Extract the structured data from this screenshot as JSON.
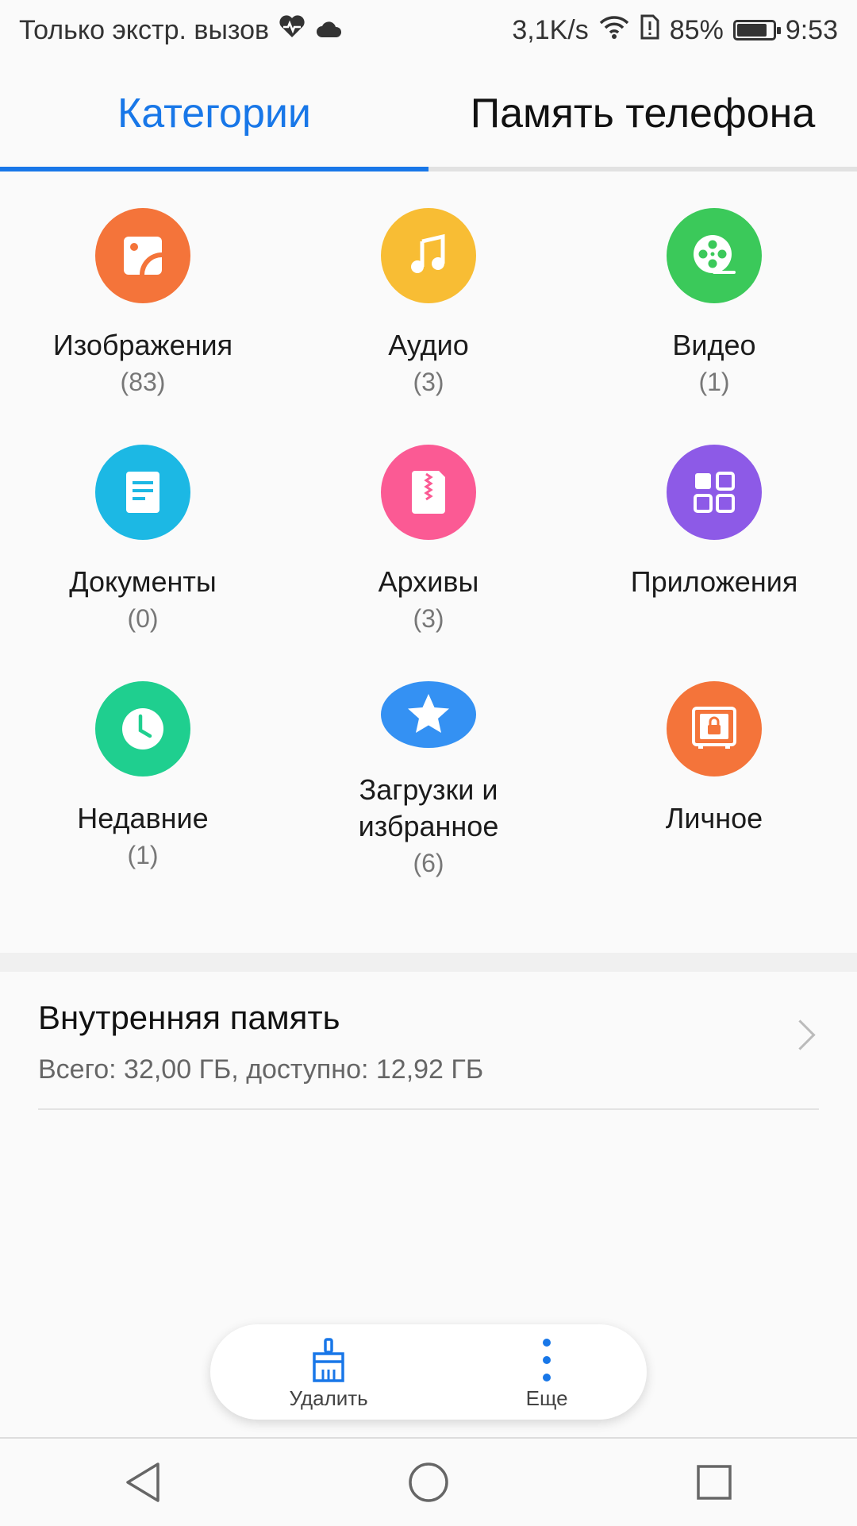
{
  "status": {
    "left_text": "Только экстр. вызов",
    "speed": "3,1K/s",
    "battery": "85%",
    "battery_level": 0.85,
    "time": "9:53"
  },
  "tabs": [
    {
      "label": "Категории",
      "active": true
    },
    {
      "label": "Память телефона",
      "active": false
    }
  ],
  "categories": [
    {
      "label": "Изображения",
      "count": "(83)",
      "color": "#f4743a",
      "icon": "image-icon"
    },
    {
      "label": "Аудио",
      "count": "(3)",
      "color": "#f8bd34",
      "icon": "music-note-icon"
    },
    {
      "label": "Видео",
      "count": "(1)",
      "color": "#3bc95a",
      "icon": "film-reel-icon"
    },
    {
      "label": "Документы",
      "count": "(0)",
      "color": "#1cb8e4",
      "icon": "document-icon"
    },
    {
      "label": "Архивы",
      "count": "(3)",
      "color": "#fb5a94",
      "icon": "archive-zip-icon"
    },
    {
      "label": "Приложения",
      "count": "",
      "color": "#8d5ae7",
      "icon": "apps-grid-icon"
    },
    {
      "label": "Недавние",
      "count": "(1)",
      "color": "#1fcf8f",
      "icon": "clock-icon"
    },
    {
      "label": "Загрузки и избранное",
      "count": "(6)",
      "color": "#3491f3",
      "icon": "star-icon"
    },
    {
      "label": "Личное",
      "count": "",
      "color": "#f4743a",
      "icon": "safe-lock-icon"
    }
  ],
  "storage": {
    "title": "Внутренняя память",
    "subtitle": "Всего: 32,00 ГБ, доступно: 12,92 ГБ"
  },
  "actions": {
    "delete_label": "Удалить",
    "more_label": "Еще"
  },
  "colors": {
    "accent": "#1877e8"
  }
}
